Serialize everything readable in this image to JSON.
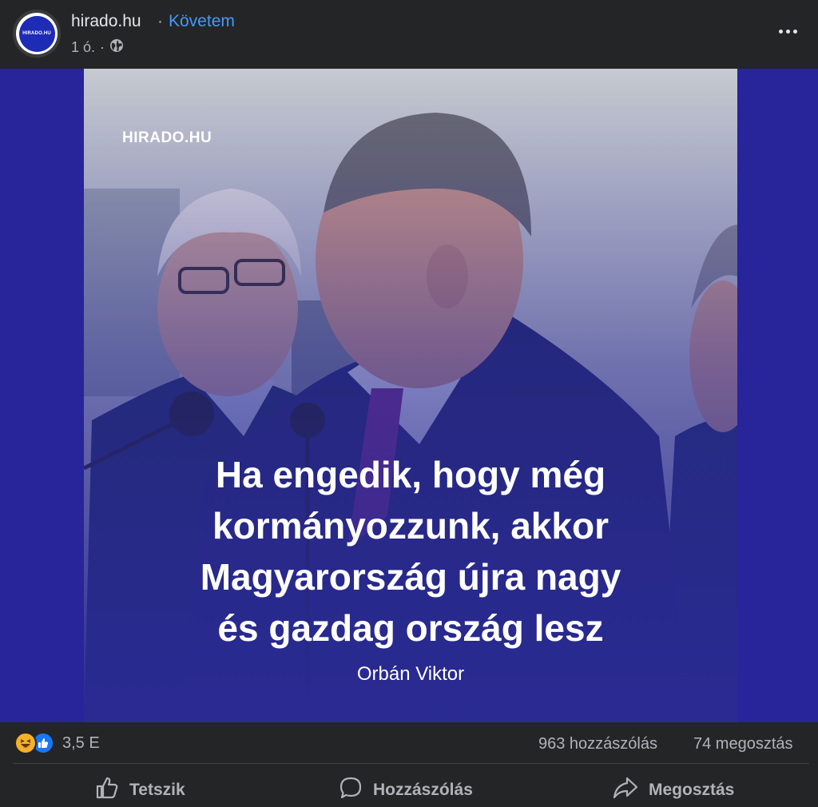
{
  "header": {
    "avatar_text": "HIRADO.HU",
    "page_name": "hirado.hu",
    "separator": "·",
    "follow_label": "Követem",
    "time": "1 ó.",
    "meta_separator": "·",
    "privacy_icon": "globe-icon",
    "more_icon": "more-dots-icon"
  },
  "post_image": {
    "watermark": "HIRADO.HU",
    "quote_lines": [
      "Ha engedik, hogy még",
      "kormányozzunk, akkor",
      "Magyarország újra nagy",
      "és gazdag ország lesz"
    ],
    "author": "Orbán Viktor",
    "colors": {
      "background": "#28249a",
      "text": "#ffffff"
    }
  },
  "stats": {
    "reaction_icons": [
      "haha-icon",
      "like-icon"
    ],
    "reaction_count": "3,5 E",
    "comments": "963 hozzászólás",
    "shares": "74 megosztás"
  },
  "actions": {
    "like_label": "Tetszik",
    "comment_label": "Hozzászólás",
    "share_label": "Megosztás"
  },
  "colors": {
    "surface": "#242526",
    "primary_text": "#e4e6eb",
    "secondary_text": "#b0b3b8",
    "link": "#4599ff"
  }
}
